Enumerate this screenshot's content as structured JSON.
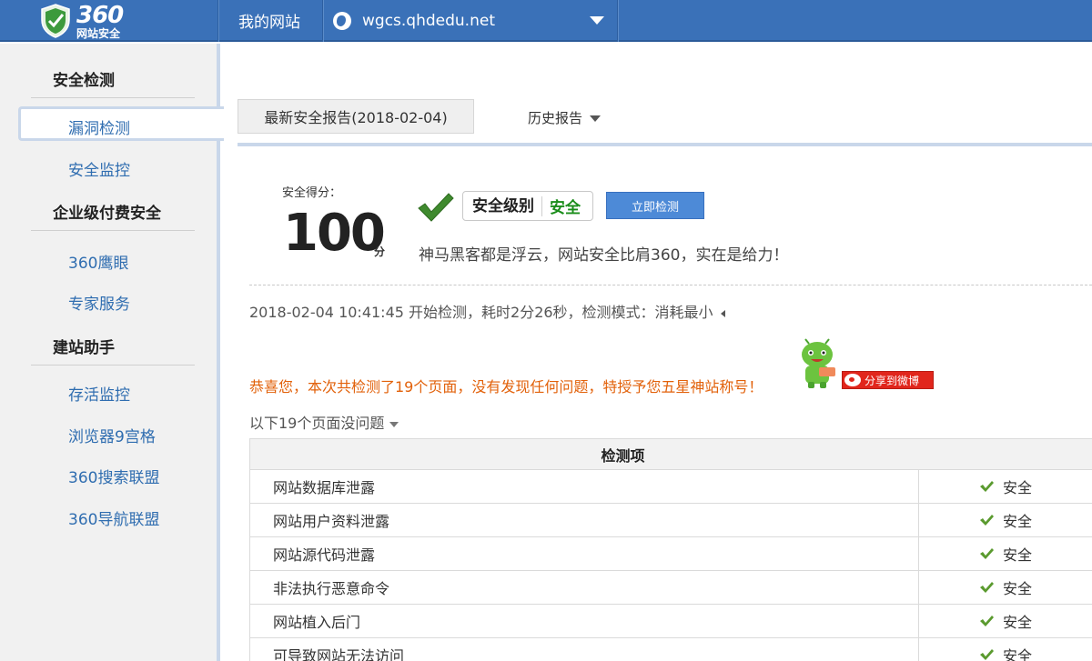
{
  "header": {
    "logo_number": "360",
    "logo_subtitle": "网站安全",
    "nav_my_site": "我的网站",
    "site_domain": "wgcs.qhdedu.net",
    "colors": {
      "bar": "#3a71b8"
    }
  },
  "sidebar": {
    "section_security": "安全检测",
    "item_vuln": "漏洞检测",
    "item_monitor": "安全监控",
    "section_enterprise": "企业级付费安全",
    "item_eagle": "360鹰眼",
    "item_expert": "专家服务",
    "section_assistant": "建站助手",
    "item_alive": "存活监控",
    "item_browser": "浏览器9宫格",
    "item_search": "360搜索联盟",
    "item_nav": "360导航联盟"
  },
  "tabs": {
    "latest": "最新安全报告(2018-02-04)",
    "history": "历史报告"
  },
  "score": {
    "label": "安全得分：",
    "value": "100",
    "unit": "分",
    "level_label": "安全级别",
    "level_value": "安全",
    "check_button": "立即检测",
    "slogan": "神马黑客都是浮云，网站安全比肩360，实在是给力！"
  },
  "scan_info": "2018-02-04 10:41:45 开始检测，耗时2分26秒，检测模式：消耗最小",
  "congrats": "恭喜您，本次共检测了19个页面，没有发现任何问题，特授予您五星神站称号！",
  "share_label": "分享到微博",
  "pages_summary": "以下19个页面没问题",
  "table": {
    "header": "检测项",
    "rows": [
      {
        "name": "网站数据库泄露",
        "status": "安全"
      },
      {
        "name": "网站用户资料泄露",
        "status": "安全"
      },
      {
        "name": "网站源代码泄露",
        "status": "安全"
      },
      {
        "name": "非法执行恶意命令",
        "status": "安全"
      },
      {
        "name": "网站植入后门",
        "status": "安全"
      },
      {
        "name": "可导致网站无法访问",
        "status": "安全"
      }
    ]
  }
}
